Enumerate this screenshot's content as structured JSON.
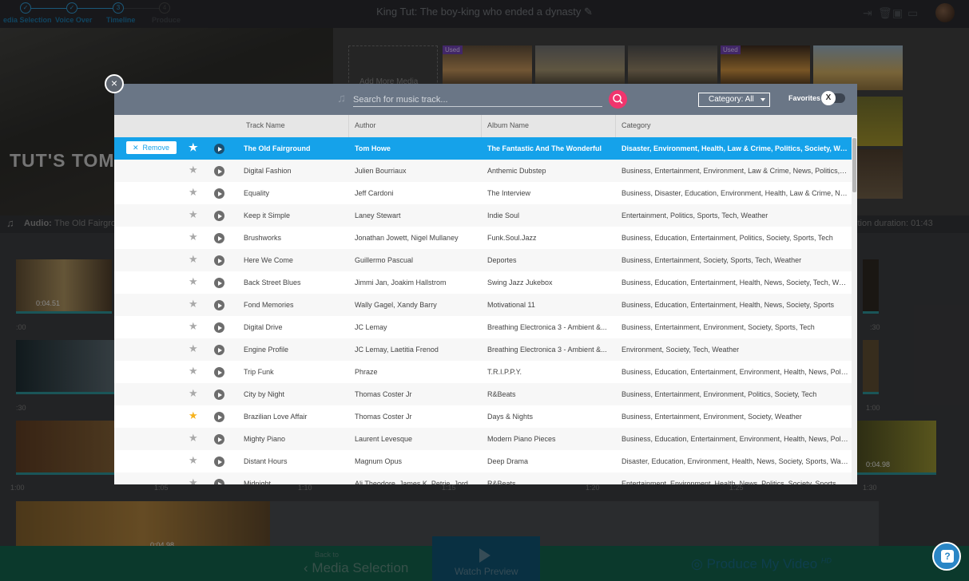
{
  "app": {
    "project_title": "King Tut: The boy-king who ended a dynasty",
    "steps": [
      "edia Selection",
      "Voice Over",
      "Timeline",
      "Produce"
    ],
    "step_marks": [
      "✓",
      "✓",
      "3",
      "4"
    ]
  },
  "editor": {
    "preview_text": "TUT'S TOM",
    "add_media_label": "Add More Media",
    "used_badge": "Used",
    "audio_label": "Audio:",
    "audio_track": "The Old Fairgrou",
    "duration_text": "ction duration: 01:43",
    "clip_durations": [
      "0:04.51",
      "0:04.98",
      "0:04.98"
    ],
    "timecodes": [
      ":00",
      ":30",
      "1:00",
      "1:05",
      "1:10",
      "1:15",
      "1:20",
      "1:25",
      "1:30",
      ":30",
      "1:00"
    ]
  },
  "footer": {
    "back_small": "Back to",
    "back_big": "Media Selection",
    "watch_preview": "Watch Preview",
    "produce": "Produce My Video",
    "hd_badge": "HD"
  },
  "music_modal": {
    "search_placeholder": "Search for music track...",
    "category_label": "Category: All",
    "favorites_label": "Favorites",
    "favorites_toggle": "X",
    "close_label": "×",
    "remove_label": "Remove",
    "columns": [
      "Track Name",
      "Author",
      "Album Name",
      "Category"
    ],
    "tracks": [
      {
        "name": "The Old Fairground",
        "author": "Tom Howe",
        "album": "The Fantastic And The Wonderful",
        "category": "Disaster, Environment, Health, Law & Crime, Politics, Society, War & C...",
        "selected": true,
        "favorite": false
      },
      {
        "name": "Digital Fashion",
        "author": "Julien Bourriaux",
        "album": "Anthemic Dubstep",
        "category": "Business, Entertainment, Environment, Law & Crime, News, Politics, S...",
        "selected": false,
        "favorite": false
      },
      {
        "name": "Equality",
        "author": "Jeff Cardoni",
        "album": "The Interview",
        "category": "Business, Disaster, Education, Environment, Health, Law & Crime, New...",
        "selected": false,
        "favorite": false
      },
      {
        "name": "Keep it Simple",
        "author": "Laney Stewart",
        "album": "Indie Soul",
        "category": "Entertainment, Politics, Sports, Tech, Weather",
        "selected": false,
        "favorite": false
      },
      {
        "name": "Brushworks",
        "author": "Jonathan Jowett, Nigel Mullaney",
        "album": "Funk.Soul.Jazz",
        "category": "Business, Education, Entertainment, Politics, Society, Sports, Tech",
        "selected": false,
        "favorite": false
      },
      {
        "name": "Here We Come",
        "author": "Guillermo Pascual",
        "album": "Deportes",
        "category": "Business, Entertainment, Society, Sports, Tech, Weather",
        "selected": false,
        "favorite": false
      },
      {
        "name": "Back Street Blues",
        "author": "Jimmi Jan, Joakim Hallstrom",
        "album": "Swing Jazz Jukebox",
        "category": "Business, Education, Entertainment, Health, News, Society, Tech, Wea...",
        "selected": false,
        "favorite": false
      },
      {
        "name": "Fond Memories",
        "author": "Wally Gagel, Xandy Barry",
        "album": "Motivational 11",
        "category": "Business, Education, Entertainment, Health, News, Society, Sports",
        "selected": false,
        "favorite": false
      },
      {
        "name": "Digital Drive",
        "author": "JC Lemay",
        "album": "Breathing Electronica 3 - Ambient &...",
        "category": "Business, Entertainment, Environment, Society, Sports, Tech",
        "selected": false,
        "favorite": false
      },
      {
        "name": "Engine Profile",
        "author": "JC Lemay, Laetitia Frenod",
        "album": "Breathing Electronica 3 - Ambient &...",
        "category": "Environment, Society, Tech, Weather",
        "selected": false,
        "favorite": false
      },
      {
        "name": "Trip Funk",
        "author": "Phraze",
        "album": "T.R.I.P.P.Y.",
        "category": "Business, Education, Entertainment, Environment, Health, News, Polit...",
        "selected": false,
        "favorite": false
      },
      {
        "name": "City by Night",
        "author": "Thomas Coster Jr",
        "album": "R&Beats",
        "category": "Business, Entertainment, Environment, Politics, Society, Tech",
        "selected": false,
        "favorite": false
      },
      {
        "name": "Brazilian Love Affair",
        "author": "Thomas Coster Jr",
        "album": "Days & Nights",
        "category": "Business, Entertainment, Environment, Society, Weather",
        "selected": false,
        "favorite": true
      },
      {
        "name": "Mighty Piano",
        "author": "Laurent Levesque",
        "album": "Modern Piano Pieces",
        "category": "Business, Education, Entertainment, Environment, Health, News, Polit...",
        "selected": false,
        "favorite": false
      },
      {
        "name": "Distant Hours",
        "author": "Magnum Opus",
        "album": "Deep Drama",
        "category": "Disaster, Education, Environment, Health, News, Society, Sports, War ...",
        "selected": false,
        "favorite": false
      },
      {
        "name": "Midnight",
        "author": "Ali Theodore, James K. Petrie, Jord...",
        "album": "R&Beats",
        "category": "Entertainment, Environment, Health, News, Politics, Society, Sports",
        "selected": false,
        "favorite": false
      }
    ]
  },
  "colors": {
    "accent_blue": "#15a2ea",
    "search_pink": "#f0356d",
    "favorite_star": "#f6b21c",
    "modal_header": "#6a7686"
  }
}
